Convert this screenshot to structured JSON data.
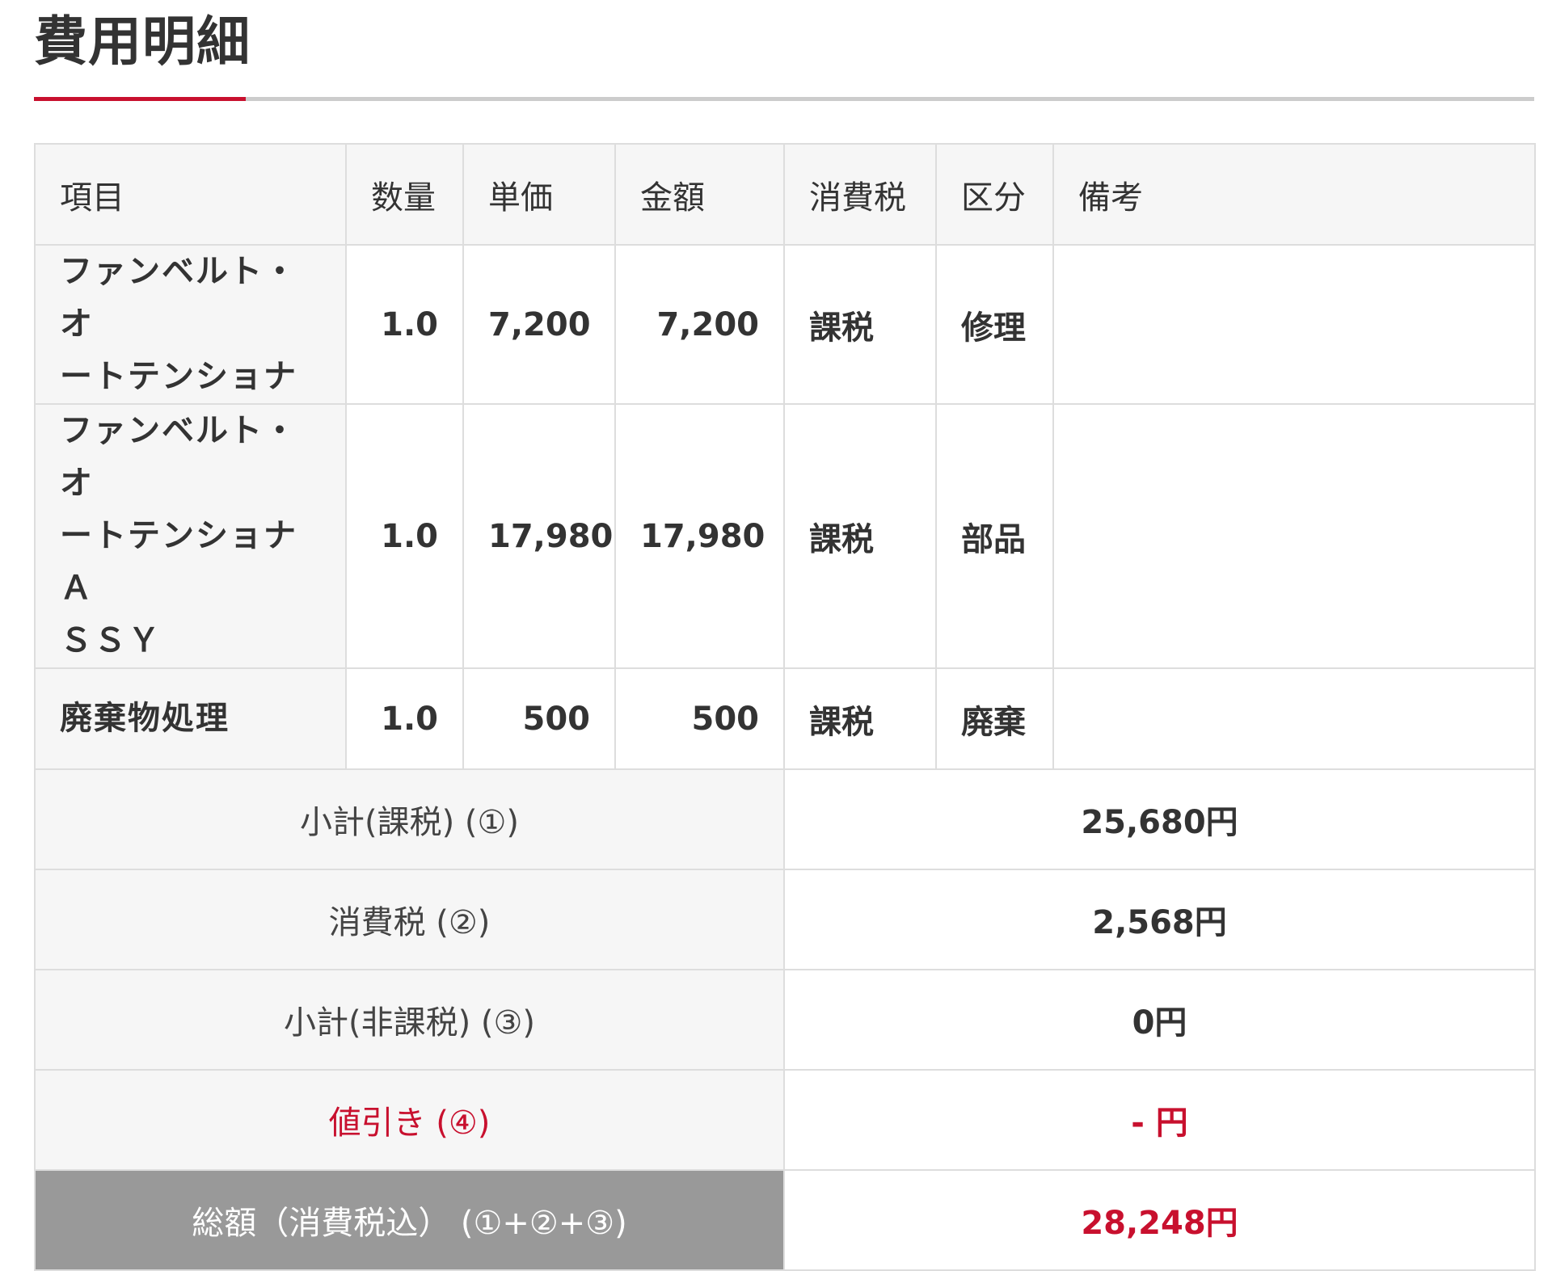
{
  "page_title": "費用明細",
  "table": {
    "headers": {
      "item": "項目",
      "qty": "数量",
      "unit_price": "単価",
      "amount": "金額",
      "tax": "消費税",
      "category": "区分",
      "notes": "備考"
    },
    "rows": [
      {
        "item_line1": "ファンベルト・オ",
        "item_line2": "ートテンショナ",
        "item_line3": "",
        "qty": "1.0",
        "unit_price": "7,200",
        "amount": "7,200",
        "tax": "課税",
        "category": "修理",
        "notes": ""
      },
      {
        "item_line1": "ファンベルト・オ",
        "item_line2": "ートテンショナＡ",
        "item_line3": "ＳＳＹ",
        "qty": "1.0",
        "unit_price": "17,980",
        "amount": "17,980",
        "tax": "課税",
        "category": "部品",
        "notes": ""
      },
      {
        "item_line1": "廃棄物処理",
        "item_line2": "",
        "item_line3": "",
        "qty": "1.0",
        "unit_price": "500",
        "amount": "500",
        "tax": "課税",
        "category": "廃棄",
        "notes": ""
      }
    ]
  },
  "summary": {
    "subtotal_taxable_label": "小計(課税) (①)",
    "subtotal_taxable_value": "25,680円",
    "consumption_tax_label": "消費税 (②)",
    "consumption_tax_value": "2,568円",
    "subtotal_nontaxable_label": "小計(非課税) (③)",
    "subtotal_nontaxable_value": "0円",
    "discount_label": "値引き (④)",
    "discount_value": "- 円",
    "total_label": "総額（消費税込） (①+②+③)",
    "total_value": "28,248円"
  },
  "colors": {
    "accent": "#c8102e",
    "header_bg": "#f6f6f6",
    "total_label_bg": "#999999",
    "border": "#dddddd"
  }
}
